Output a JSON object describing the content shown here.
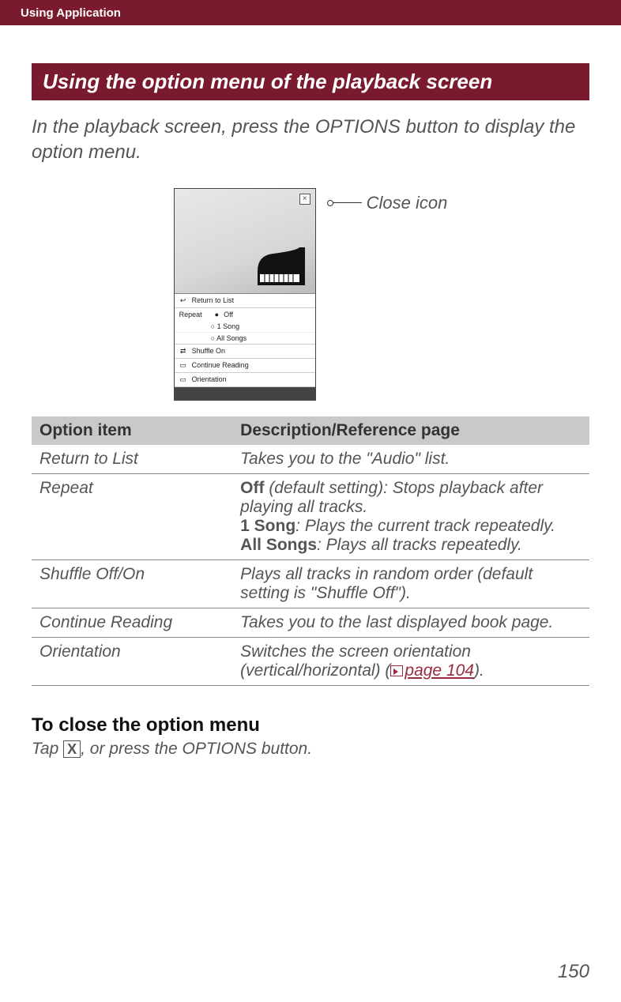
{
  "header": {
    "tab": "Using Application"
  },
  "section_title": "Using the option menu of the playback screen",
  "intro": "In the playback screen, press the OPTIONS button to display the option menu.",
  "figure": {
    "close_label": "Close icon",
    "close_glyph": "×",
    "menu_items": {
      "return": "Return to List",
      "repeat": "Repeat",
      "off": "Off",
      "one_song": "1 Song",
      "all_songs": "All Songs",
      "shuffle": "Shuffle On",
      "continue": "Continue Reading",
      "orientation": "Orientation"
    }
  },
  "table": {
    "head_option": "Option item",
    "head_desc": "Description/Reference page",
    "rows": {
      "return": {
        "name": "Return to List",
        "desc": "Takes you to the \"Audio\" list."
      },
      "repeat": {
        "name": "Repeat",
        "off_b": "Off",
        "off_rest": " (default setting): Stops playback after playing all tracks.",
        "one_b": "1 Song",
        "one_rest": ": Plays the current track repeatedly.",
        "all_b": "All Songs",
        "all_rest": ": Plays all tracks repeatedly."
      },
      "shuffle": {
        "name": "Shuffle Off/On",
        "desc": "Plays all tracks in random order (default setting is \"Shuffle Off\")."
      },
      "continue": {
        "name": "Continue Reading",
        "desc": "Takes you to the last displayed book page."
      },
      "orientation": {
        "name": "Orientation",
        "desc_pre": "Switches the screen orientation (vertical/horizontal) (",
        "link": "page 104",
        "desc_post": ")."
      }
    }
  },
  "close_heading": "To close the option menu",
  "close_text_pre": "Tap ",
  "close_x": "X",
  "close_text_post": ", or press the OPTIONS button.",
  "page_number": "150"
}
